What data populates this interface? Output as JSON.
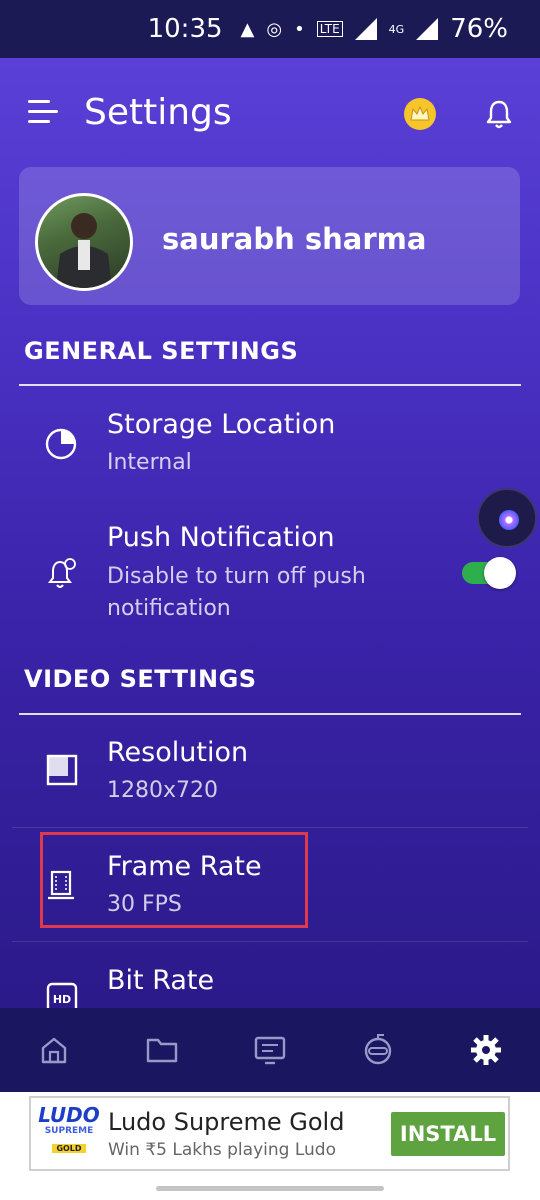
{
  "status_bar": {
    "time": "10:35",
    "alert_icon": "▲",
    "record_icon": "◎",
    "dot": "•",
    "network": "LTE",
    "network_4g": "4G",
    "battery": "76%"
  },
  "header": {
    "title": "Settings"
  },
  "profile": {
    "name": "saurabh sharma"
  },
  "general": {
    "heading": "GENERAL SETTINGS",
    "items": [
      {
        "title": "Storage Location",
        "subtitle": "Internal"
      },
      {
        "title": "Push Notification",
        "subtitle": "Disable to turn off push notification",
        "toggle_on": true
      }
    ]
  },
  "video": {
    "heading": "VIDEO SETTINGS",
    "items": [
      {
        "title": "Resolution",
        "subtitle": "1280x720"
      },
      {
        "title": "Frame Rate",
        "subtitle": "30 FPS"
      },
      {
        "title": "Bit Rate"
      }
    ]
  },
  "bottom_nav": {
    "items": [
      "home-icon",
      "folder-icon",
      "screen-icon",
      "gamer-icon",
      "gear-icon"
    ],
    "active": "gear-icon"
  },
  "ad": {
    "logo_line1": "LUDO",
    "logo_line2": "SUPREME",
    "logo_line3": "GOLD",
    "title": "Ludo Supreme Gold",
    "subtitle": "Win ₹5 Lakhs playing Ludo",
    "install_label": "INSTALL"
  },
  "colors": {
    "highlight": "#e0384d",
    "toggle_on": "#2fae4e",
    "install": "#5ea33f"
  }
}
